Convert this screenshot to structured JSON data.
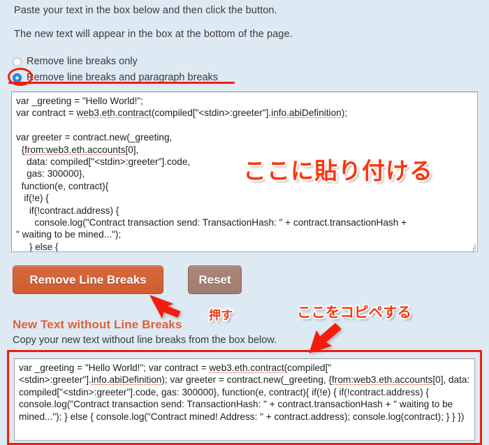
{
  "page": {
    "background_color": "#dde9f3",
    "accent_color": "#e0603a",
    "annotation_color": "#f41c0c"
  },
  "intro": {
    "line1": "Paste your text in the box below and then click the button.",
    "line2": "The new text will appear in the box at the bottom of the page."
  },
  "options": {
    "items": [
      {
        "label": "Remove line breaks only",
        "selected": false
      },
      {
        "label": "Remove line breaks and paragraph breaks",
        "selected": true
      }
    ]
  },
  "input_area": {
    "value": "var _greeting = \"Hello World!\";\nvar contract = web3.eth.contract(compiled[\"<stdin>:greeter\"].info.abiDefinition);\n\nvar greeter = contract.new(_greeting,\n  {from:web3.eth.accounts[0],\n    data: compiled[\"<stdin>:greeter\"].code,\n    gas: 300000},\n  function(e, contract){\n   if(!e) {\n     if(!contract.address) {\n       console.log(\"Contract transaction send: TransactionHash: \" + contract.transactionHash +\n\" waiting to be mined...\");\n     } else {"
  },
  "buttons": {
    "remove_label": "Remove Line Breaks",
    "remove_color": "#cf5c31",
    "reset_label": "Reset",
    "reset_color": "#a27c6e"
  },
  "output": {
    "heading": "New Text without Line Breaks",
    "subtitle": "Copy your new text without line breaks from the box below.",
    "value": "var _greeting = \"Hello World!\"; var contract = web3.eth.contract(compiled[\"<stdin>:greeter\"].info.abiDefinition); var greeter = contract.new(_greeting, {from:web3.eth.accounts[0], data: compiled[\"<stdin>:greeter\"].code, gas: 300000}, function(e, contract){ if(!e) { if(!contract.address) { console.log(\"Contract transaction send: TransactionHash: \" + contract.transactionHash + \" waiting to be mined...\"); } else { console.log(\"Contract mined! Address: \" + contract.address); console.log(contract); } } })"
  },
  "annotations": {
    "paste_here": "ここに貼り付ける",
    "press": "押す",
    "copy_paste_here": "ここをコピペする"
  }
}
